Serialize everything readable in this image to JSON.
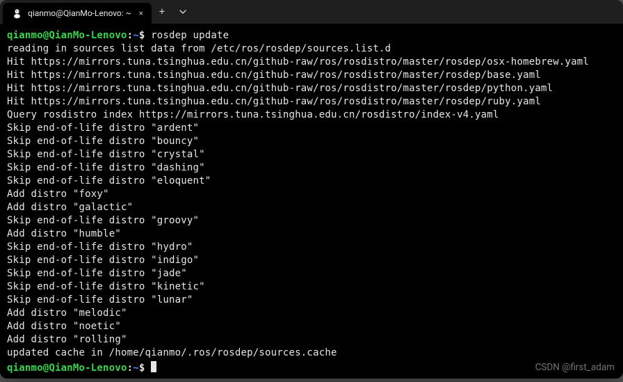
{
  "tab": {
    "title": "qianmo@QianMo-Lenovo: ~"
  },
  "icons": {
    "new_tab": "+",
    "chevron": "⌄",
    "close": "×"
  },
  "prompt": {
    "user_host": "qianmo@QianMo-Lenovo",
    "colon": ":",
    "path": "~",
    "symbol": "$"
  },
  "command": "rosdep update",
  "output_lines": [
    "reading in sources list data from /etc/ros/rosdep/sources.list.d",
    "Hit https://mirrors.tuna.tsinghua.edu.cn/github-raw/ros/rosdistro/master/rosdep/osx-homebrew.yaml",
    "Hit https://mirrors.tuna.tsinghua.edu.cn/github-raw/ros/rosdistro/master/rosdep/base.yaml",
    "Hit https://mirrors.tuna.tsinghua.edu.cn/github-raw/ros/rosdistro/master/rosdep/python.yaml",
    "Hit https://mirrors.tuna.tsinghua.edu.cn/github-raw/ros/rosdistro/master/rosdep/ruby.yaml",
    "Query rosdistro index https://mirrors.tuna.tsinghua.edu.cn/rosdistro/index-v4.yaml",
    "Skip end-of-life distro \"ardent\"",
    "Skip end-of-life distro \"bouncy\"",
    "Skip end-of-life distro \"crystal\"",
    "Skip end-of-life distro \"dashing\"",
    "Skip end-of-life distro \"eloquent\"",
    "Add distro \"foxy\"",
    "Add distro \"galactic\"",
    "Skip end-of-life distro \"groovy\"",
    "Add distro \"humble\"",
    "Skip end-of-life distro \"hydro\"",
    "Skip end-of-life distro \"indigo\"",
    "Skip end-of-life distro \"jade\"",
    "Skip end-of-life distro \"kinetic\"",
    "Skip end-of-life distro \"lunar\"",
    "Add distro \"melodic\"",
    "Add distro \"noetic\"",
    "Add distro \"rolling\"",
    "updated cache in /home/qianmo/.ros/rosdep/sources.cache"
  ],
  "watermark": "CSDN @first_adam"
}
